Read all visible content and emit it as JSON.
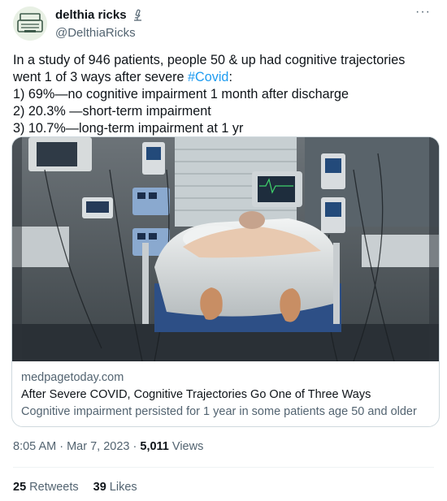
{
  "author": {
    "display_name": "delthia ricks",
    "handle": "@DelthiaRicks",
    "badge_icon": "microscope-icon"
  },
  "tweet": {
    "lines": [
      "In a study of 946 patients, people 50 & up had cognitive trajectories",
      "went 1 of 3 ways after severe ",
      "1) 69%—no cognitive impairment 1 month after discharge",
      "2) 20.3% —short-term impairment",
      "3) 10.7%—long-term impairment at 1 yr"
    ],
    "hashtag": "#Covid",
    "after_hashtag": ":"
  },
  "card": {
    "domain": "medpagetoday.com",
    "title": "After Severe COVID, Cognitive Trajectories Go One of Three Ways",
    "description": "Cognitive impairment persisted for 1 year in some patients age 50 and older"
  },
  "meta": {
    "time": "8:05 AM",
    "separator": " · ",
    "date": "Mar 7, 2023",
    "views_count": "5,011",
    "views_label": " Views"
  },
  "stats": {
    "retweets_count": "25",
    "retweets_label": "Retweets",
    "likes_count": "39",
    "likes_label": "Likes"
  },
  "colors": {
    "accent": "#1d9bf0",
    "text": "#0f1419",
    "secondary": "#536471",
    "border": "#cfd9de"
  }
}
